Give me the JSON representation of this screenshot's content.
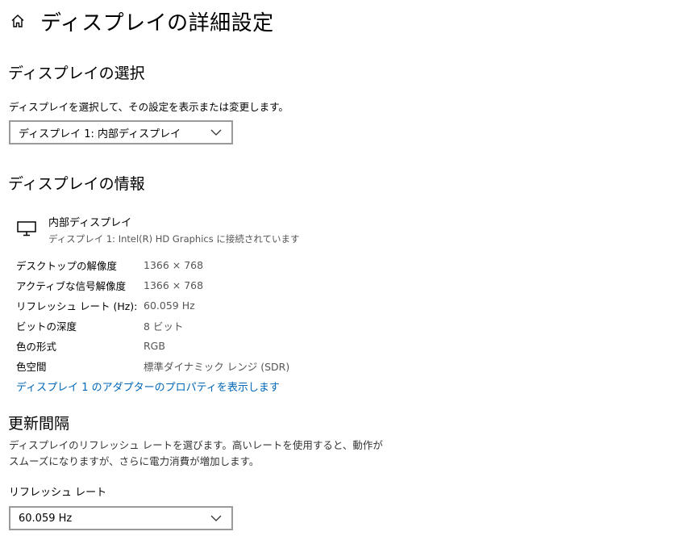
{
  "header": {
    "home_icon": "home-icon",
    "title": "ディスプレイの詳細設定"
  },
  "select_section": {
    "heading": "ディスプレイの選択",
    "description": "ディスプレイを選択して、その設定を表示または変更します。",
    "dropdown_value": "ディスプレイ 1: 内部ディスプレイ"
  },
  "info_section": {
    "heading": "ディスプレイの情報",
    "monitor_icon": "monitor-icon",
    "monitor_name": "内部ディスプレイ",
    "monitor_connection": "ディスプレイ 1: Intel(R) HD Graphics に接続されています",
    "rows": [
      {
        "label": "デスクトップの解像度",
        "value": "1366 × 768"
      },
      {
        "label": "アクティブな信号解像度",
        "value": "1366 × 768"
      },
      {
        "label": "リフレッシュ レート (Hz):",
        "value": "60.059 Hz"
      },
      {
        "label": "ビットの深度",
        "value": "8 ビット"
      },
      {
        "label": "色の形式",
        "value": "RGB"
      },
      {
        "label": "色空間",
        "value": "標準ダイナミック レンジ (SDR)"
      }
    ],
    "adapter_link": "ディスプレイ 1 のアダプターのプロパティを表示します"
  },
  "refresh_section": {
    "heading": "更新間隔",
    "description": "ディスプレイのリフレッシュ レートを選びます。高いレートを使用すると、動作がスムーズになりますが、さらに電力消費が増加します。",
    "field_label": "リフレッシュ レート",
    "dropdown_value": "60.059 Hz"
  },
  "colors": {
    "link": "#0067b8",
    "dropdown_border": "#9a9a9a"
  }
}
